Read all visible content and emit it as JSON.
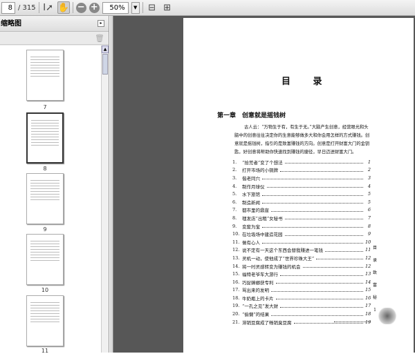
{
  "toolbar": {
    "page_current": "8",
    "page_total": "/ 315",
    "zoom": "50%"
  },
  "sidebar": {
    "title": "缩略图",
    "thumbnails": [
      "7",
      "8",
      "9",
      "10",
      "11"
    ]
  },
  "page": {
    "title": "目 录",
    "chapter": "第一章　创意就是摇钱树",
    "intro": "古人云：“万物生于有，有生于无。”大脑产生创意，经营眼光和头脑中的创意往往决定你的生意能够做多大和你会用怎样的方式赚钱。创意就是摇钱树，指引的是致富赚钱的方向。创意是打开财富大门的金钥匙，好创意将帮助你快速找到赚钱的捷径，早日迈进财富大门。",
    "toc": [
      {
        "n": "1.",
        "t": "“拾荒者”变了个想法",
        "p": "1"
      },
      {
        "n": "2.",
        "t": "打开市场的小铜牌",
        "p": "2"
      },
      {
        "n": "3.",
        "t": "偕老同穴",
        "p": "3"
      },
      {
        "n": "4.",
        "t": "制作月球仪",
        "p": "4"
      },
      {
        "n": "5.",
        "t": "水下旅馆",
        "p": "5"
      },
      {
        "n": "6.",
        "t": "制造新闻",
        "p": "5"
      },
      {
        "n": "7.",
        "t": "都市里的鼎崖",
        "p": "6"
      },
      {
        "n": "8.",
        "t": "理发店“出租”女秘书",
        "p": "7"
      },
      {
        "n": "9.",
        "t": "变废为宝",
        "p": "8"
      },
      {
        "n": "10.",
        "t": "在垃圾场中建造花园",
        "p": "9"
      },
      {
        "n": "11.",
        "t": "做有心人",
        "p": "10"
      },
      {
        "n": "12.",
        "t": "说不定有一天这个东西会替我赚进一笔钱",
        "p": "11"
      },
      {
        "n": "13.",
        "t": "灵机一动，使他成了“世界珍珠大王”",
        "p": "12"
      },
      {
        "n": "14.",
        "t": "将一时灵感转变为赚钱的机会",
        "p": "12"
      },
      {
        "n": "15.",
        "t": "福特老爷车大游行",
        "p": "13"
      },
      {
        "n": "16.",
        "t": "巧捉蟑螂获专利",
        "p": "14"
      },
      {
        "n": "17.",
        "t": "骂出来的发明",
        "p": "15"
      },
      {
        "n": "18.",
        "t": "牛奶瓶上的卡片",
        "p": "16"
      },
      {
        "n": "19.",
        "t": "“一孔之见”发大财",
        "p": "17"
      },
      {
        "n": "20.",
        "t": "“偷懒”的结果",
        "p": "18"
      },
      {
        "n": "21.",
        "t": "滞销豆腐成了畅销臭豆腐",
        "p": "19"
      }
    ],
    "side_label_1": "目",
    "side_label_2": "录",
    "side_label_3": "致富",
    "side_label_4": "秘",
    "page_number": "1"
  }
}
